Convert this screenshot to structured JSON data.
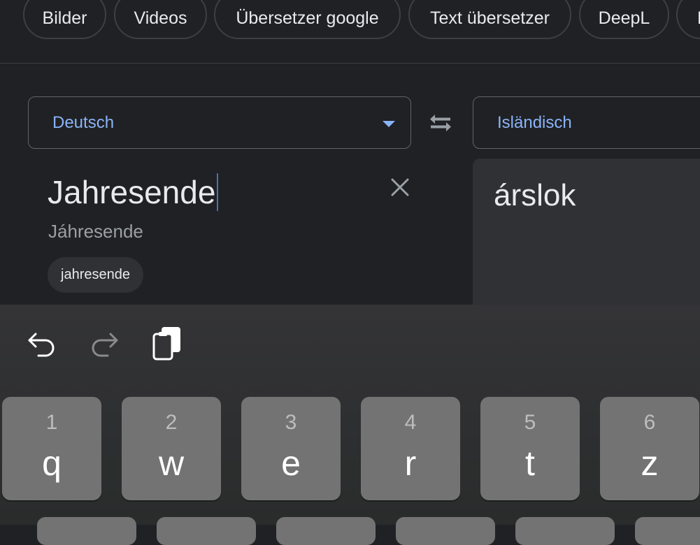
{
  "chips": [
    "Bilder",
    "Videos",
    "Übersetzer google",
    "Text übersetzer",
    "DeepL",
    "L"
  ],
  "source_lang": "Deutsch",
  "target_lang": "Isländisch",
  "source_text": "Jahresende",
  "transliteration": "Jáhresende",
  "suggestion": "jahresende",
  "translation": "árslok",
  "keyboard": {
    "keys": [
      {
        "num": "1",
        "letter": "q"
      },
      {
        "num": "2",
        "letter": "w"
      },
      {
        "num": "3",
        "letter": "e"
      },
      {
        "num": "4",
        "letter": "r"
      },
      {
        "num": "5",
        "letter": "t"
      },
      {
        "num": "6",
        "letter": "z"
      }
    ]
  },
  "icons": {
    "undo": "undo-icon",
    "redo": "redo-icon",
    "paste": "paste-icon",
    "swap": "swap-languages-icon",
    "clear": "close-icon",
    "dropdown": "chevron-down-icon"
  },
  "colors": {
    "background": "#202124",
    "accent": "#8ab4f8",
    "key": "#737373"
  }
}
